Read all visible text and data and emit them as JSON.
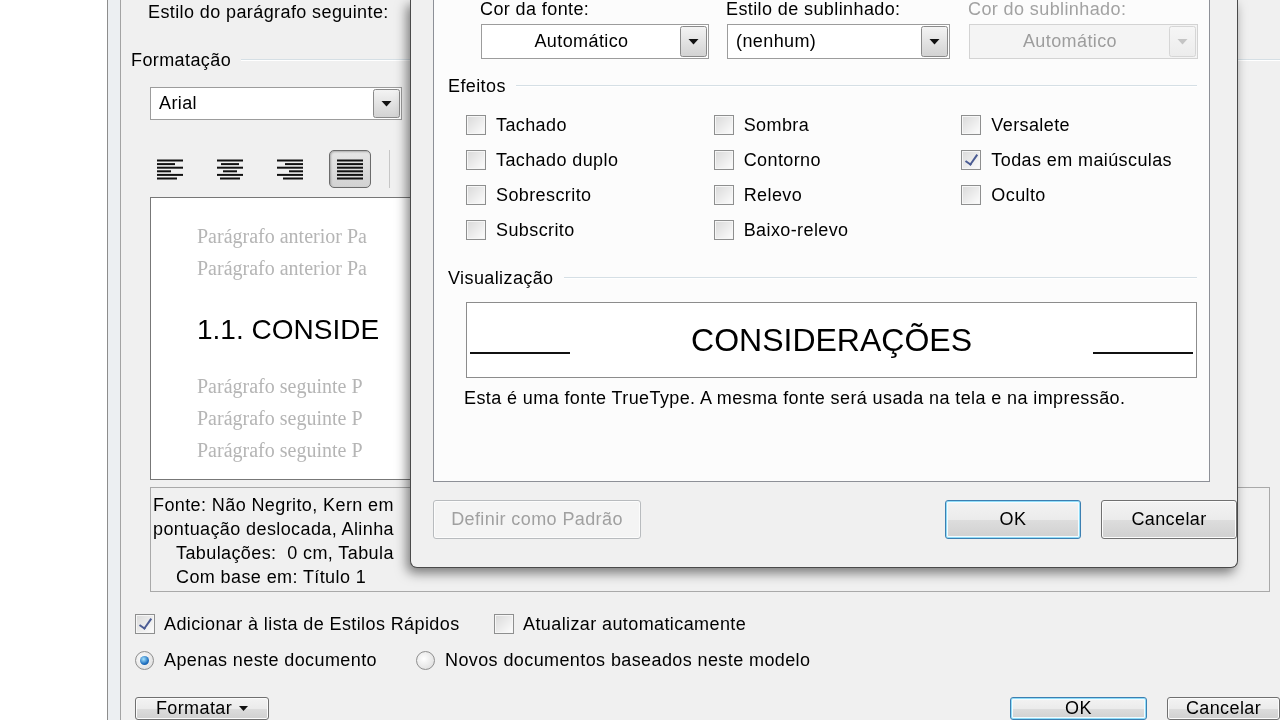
{
  "style_dialog": {
    "next_style_label": "Estilo do parágrafo seguinte:",
    "formatting_title": "Formatação",
    "font_dropdown": {
      "value": "Arial"
    },
    "alignment_buttons": [
      {
        "kind": "left",
        "selected": false
      },
      {
        "kind": "center",
        "selected": false
      },
      {
        "kind": "right",
        "selected": false
      },
      {
        "kind": "justify",
        "selected": true
      }
    ],
    "preview": {
      "previous_paragraph": [
        "Parágrafo anterior Pa",
        "Parágrafo anterior Pa"
      ],
      "heading": "1.1. CONSIDE",
      "following_paragraph": [
        "Parágrafo seguinte P",
        "Parágrafo seguinte P",
        "Parágrafo seguinte P"
      ]
    },
    "description": {
      "lines": [
        "Fonte: Não Negrito, Kern em",
        "pontuação deslocada, Alinha"
      ],
      "details": [
        "Tabulações:  0 cm, Tabula",
        "Com base em: Título 1"
      ]
    },
    "options": [
      {
        "label": "Adicionar à lista de Estilos Rápidos",
        "checked": true
      },
      {
        "label": "Atualizar automaticamente",
        "checked": false
      }
    ],
    "scope": [
      {
        "label": "Apenas neste documento",
        "selected": true
      },
      {
        "label": "Novos documentos baseados neste modelo",
        "selected": false
      }
    ],
    "buttons": [
      {
        "label": "Formatar",
        "menu": true,
        "default": false
      },
      {
        "label": "OK",
        "menu": false,
        "default": true
      },
      {
        "label": "Cancelar",
        "menu": false,
        "default": false
      }
    ]
  },
  "font_dialog": {
    "dropdowns": [
      {
        "kind": "color",
        "label": "Cor da fonte:",
        "value": "Automático",
        "disabled": false
      },
      {
        "kind": "list",
        "label": "Estilo de sublinhado:",
        "value": "(nenhum)",
        "disabled": false
      },
      {
        "kind": "color",
        "label": "Cor do sublinhado:",
        "value": "Automático",
        "disabled": true
      }
    ],
    "effects_title": "Efeitos",
    "effect_columns": [
      {
        "items": [
          {
            "label": "Tachado",
            "checked": false
          },
          {
            "label": "Tachado duplo",
            "checked": false
          },
          {
            "label": "Sobrescrito",
            "checked": false
          },
          {
            "label": "Subscrito",
            "checked": false
          }
        ]
      },
      {
        "items": [
          {
            "label": "Sombra",
            "checked": false
          },
          {
            "label": "Contorno",
            "checked": false
          },
          {
            "label": "Relevo",
            "checked": false
          },
          {
            "label": "Baixo-relevo",
            "checked": false
          }
        ]
      },
      {
        "items": [
          {
            "label": "Versalete",
            "checked": false
          },
          {
            "label": "Todas em maiúsculas",
            "checked": true
          },
          {
            "label": "Oculto",
            "checked": false
          }
        ]
      }
    ],
    "preview_title": "Visualização",
    "preview_sample": "CONSIDERAÇÕES",
    "preview_note": "Esta é uma fonte TrueType. A mesma fonte será usada na tela e na impressão.",
    "buttons": [
      {
        "label": "Definir como Padrão",
        "default": false,
        "disabled": true
      },
      {
        "label": "OK",
        "default": true,
        "disabled": false
      },
      {
        "label": "Cancelar",
        "default": false,
        "disabled": false
      }
    ]
  }
}
